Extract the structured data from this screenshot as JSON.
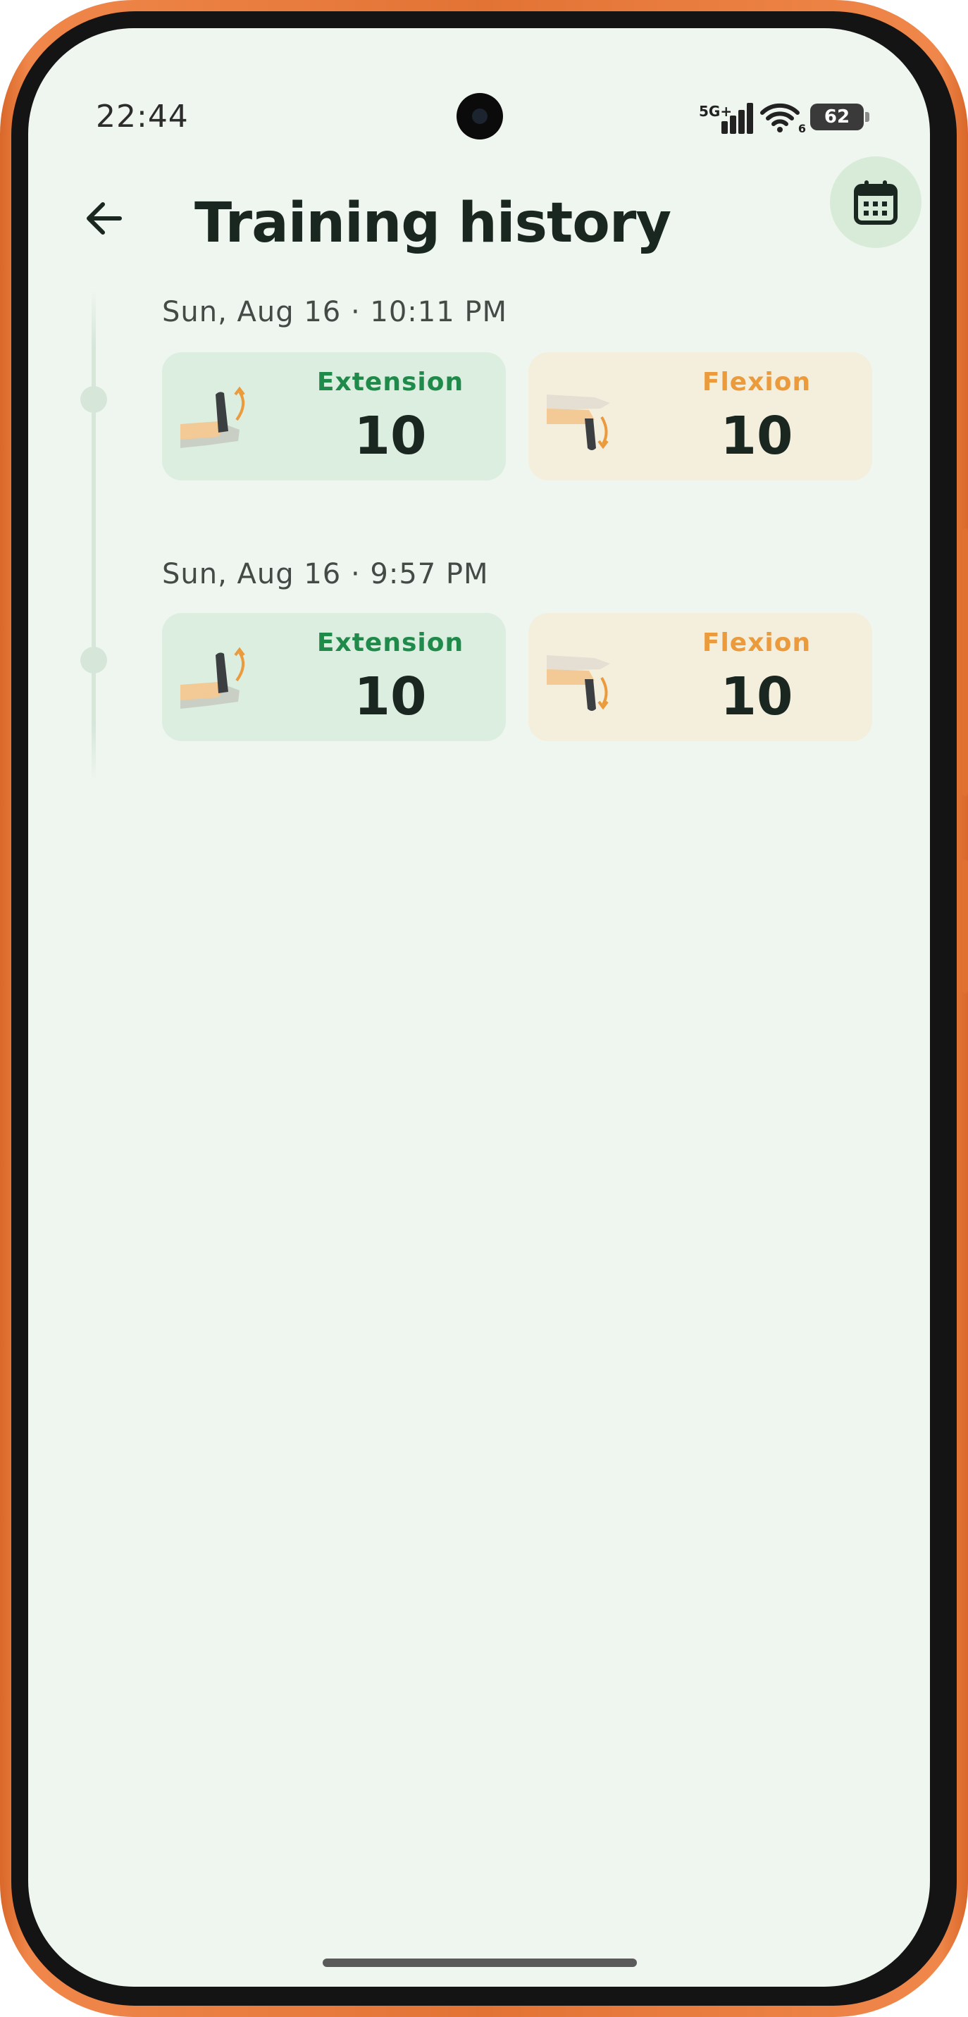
{
  "status_bar": {
    "time": "22:44",
    "network": "5G+",
    "wifi_sub": "6",
    "battery": "62"
  },
  "header": {
    "back_icon": "arrow-left-icon",
    "title": "Training history",
    "calendar_icon": "calendar-icon"
  },
  "sessions": [
    {
      "date": "Sun, Aug 16  ·  10:11 PM",
      "extension": {
        "label": "Extension",
        "count": "10"
      },
      "flexion": {
        "label": "Flexion",
        "count": "10"
      }
    },
    {
      "date": "Sun, Aug 16  ·  9:57 PM",
      "extension": {
        "label": "Extension",
        "count": "10"
      },
      "flexion": {
        "label": "Flexion",
        "count": "10"
      }
    }
  ],
  "colors": {
    "background": "#eff6ef",
    "extension_card": "#dbeee0",
    "extension_text": "#1f8a4a",
    "flexion_card": "#f4efdd",
    "flexion_text": "#eb9a3c",
    "frame": "#e27335"
  }
}
